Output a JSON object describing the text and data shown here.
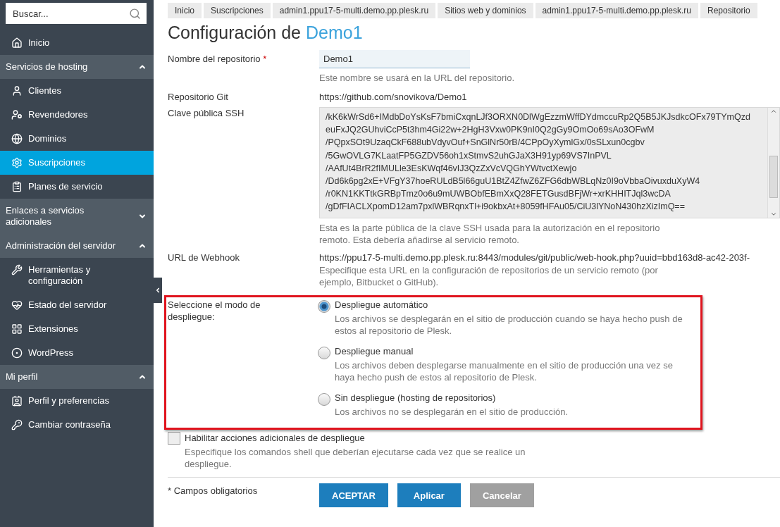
{
  "sidebar": {
    "search": {
      "placeholder": "Buscar..."
    },
    "items": [
      {
        "label": "Inicio",
        "selected": false
      }
    ],
    "sections": [
      {
        "title": "Servicios de hosting",
        "expanded": true,
        "items": [
          {
            "label": "Clientes",
            "selected": false
          },
          {
            "label": "Revendedores",
            "selected": false
          },
          {
            "label": "Dominios",
            "selected": false
          },
          {
            "label": "Suscripciones",
            "selected": true
          },
          {
            "label": "Planes de servicio",
            "selected": false
          }
        ]
      },
      {
        "title": "Enlaces a servicios adicionales",
        "expanded": false
      },
      {
        "title": "Administración del servidor",
        "expanded": true,
        "items": [
          {
            "label": "Herramientas y configuración",
            "selected": false
          },
          {
            "label": "Estado del servidor",
            "selected": false
          },
          {
            "label": "Extensiones",
            "selected": false
          },
          {
            "label": "WordPress",
            "selected": false
          }
        ]
      },
      {
        "title": "Mi perfil",
        "expanded": true,
        "items": [
          {
            "label": "Perfil y preferencias",
            "selected": false
          },
          {
            "label": "Cambiar contraseña",
            "selected": false
          }
        ]
      }
    ]
  },
  "breadcrumbs": [
    "Inicio",
    "Suscripciones",
    "admin1.ppu17-5-multi.demo.pp.plesk.ru",
    "Sitios web y dominios",
    "admin1.ppu17-5-multi.demo.pp.plesk.ru",
    "Repositorio"
  ],
  "title": {
    "prefix": "Configuración de",
    "name": "Demo1"
  },
  "form": {
    "name": {
      "label": "Nombre del repositorio",
      "required_mark": "*",
      "value": "Demo1",
      "hint": "Este nombre se usará en la URL del repositorio."
    },
    "git": {
      "label": "Repositorio Git",
      "value": "https://github.com/snovikova/Demo1"
    },
    "ssh": {
      "label": "Clave pública SSH",
      "lines": [
        "/kK6kWrSd6+IMdbDoYsKsF7bmiCxqnLJf3ORXN0DlWgEzzmWffDYdmccuRp2Q5B5JKJsdkcOFx79TYmQzd",
        "euFxJQ2GUhviCcP5t3hm4Gi22w+2HgH3Vxw0PK9nI0Q2gGy9OmOo69sAo3OFwM",
        "/PQpxSOt9UzaqCkF688ubVdyvOuf+SnGlNr50rB/4CPpOyXymlGx/0sSLxun0cgbv",
        "/5GwOVLG7KLaatFP5GZDV56oh1xStmvS2uhGJaX3H91yp69VS7InPVL",
        "/AAfUt4BrR2fIMULle3EsKWqf46vIJ3QzZxVcVQGhYWtvctXewjo",
        "/Dd6k6pg2xE+VFgY37hoeRULdB5l66guU1BtZ4ZfwZ6ZFG6dbWBLqNz0I9oVbbaOivuxduXyW4",
        "/r0KN1KKTtkGRBpTmz0o6u9mUWBObfEBmXxQ28FETGusdBFjWr+xrKHHITJql3wcDA",
        "/gDfFIACLXpomD12am7pxlWBRqnxTl+i9okbxAt+8059fHFAu05/CiU3lYNoN430hzXizImQ=="
      ],
      "hint": "Esta es la parte pública de la clave SSH usada para la autorización en el repositorio remoto. Esta debería añadirse al servicio remoto."
    },
    "webhook": {
      "label": "URL de Webhook",
      "value": "https://ppu17-5-multi.demo.pp.plesk.ru:8443/modules/git/public/web-hook.php?uuid=bbd163d8-ac42-203f-",
      "hint": "Especifique esta URL en la configuración de repositorios de un servicio remoto (por ejemplo, Bitbucket o GitHub)."
    },
    "deploy": {
      "label": "Seleccione el modo de despliegue:",
      "options": [
        {
          "label": "Despliegue automático",
          "hint": "Los archivos se desplegarán en el sitio de producción cuando se haya hecho push de estos al repositorio de Plesk.",
          "selected": true
        },
        {
          "label": "Despliegue manual",
          "hint": "Los archivos deben desplegarse manualmente en el sitio de producción una vez se haya hecho push de estos al repositorio de Plesk.",
          "selected": false
        },
        {
          "label": "Sin despliegue (hosting de repositorios)",
          "hint": "Los archivos no se desplegarán en el sitio de producción.",
          "selected": false
        }
      ]
    },
    "actions": {
      "label": "Habilitar acciones adicionales de despliegue",
      "checked": false,
      "hint": "Especifique los comandos shell que deberían ejecutarse cada vez que se realice un despliegue."
    }
  },
  "footer": {
    "note": "* Campos obligatorios",
    "buttons": [
      {
        "label": "ACEPTAR",
        "disabled": false
      },
      {
        "label": "Aplicar",
        "disabled": false
      },
      {
        "label": "Cancelar",
        "disabled": true
      }
    ]
  }
}
